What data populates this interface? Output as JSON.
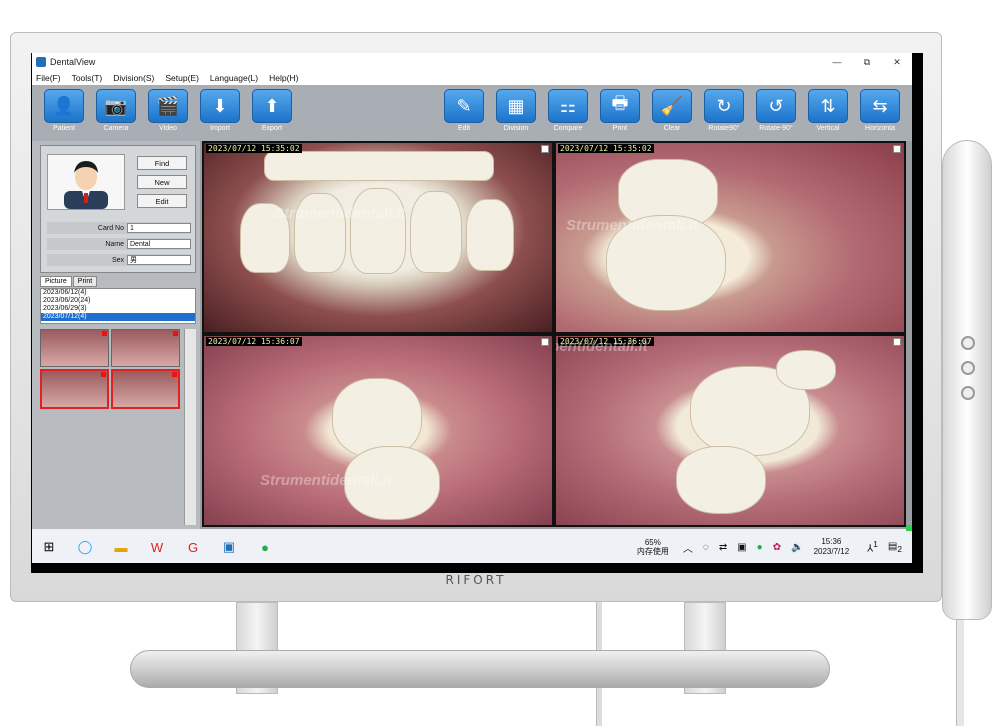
{
  "monitor": {
    "brand": "RIFORT"
  },
  "window": {
    "title": "DentalView",
    "controls": [
      "—",
      "⧉",
      "✕"
    ]
  },
  "menu": [
    "File(F)",
    "Tools(T)",
    "Division(S)",
    "Setup(E)",
    "Language(L)",
    "Help(H)"
  ],
  "toolbar_left": [
    {
      "label": "Patient",
      "icon": "patient-icon",
      "glyph": "👤"
    },
    {
      "label": "Camera",
      "icon": "camera-icon",
      "glyph": "📷"
    },
    {
      "label": "Video",
      "icon": "video-icon",
      "glyph": "🎬"
    },
    {
      "label": "Import",
      "icon": "import-icon",
      "glyph": "⬇"
    },
    {
      "label": "Export",
      "icon": "export-icon",
      "glyph": "⬆"
    }
  ],
  "toolbar_right": [
    {
      "label": "Edit",
      "icon": "edit-icon",
      "glyph": "✎"
    },
    {
      "label": "Division",
      "icon": "division-icon",
      "glyph": "▦"
    },
    {
      "label": "Compare",
      "icon": "compare-icon",
      "glyph": "⚏"
    },
    {
      "label": "Print",
      "icon": "print-icon",
      "glyph": "🖶"
    },
    {
      "label": "Clear",
      "icon": "clear-icon",
      "glyph": "🧹"
    },
    {
      "label": "Rotate90°",
      "icon": "rotate-cw-icon",
      "glyph": "↻"
    },
    {
      "label": "Rotate-90°",
      "icon": "rotate-ccw-icon",
      "glyph": "↺"
    },
    {
      "label": "Vertical",
      "icon": "flip-vertical-icon",
      "glyph": "⇅"
    },
    {
      "label": "Horizonta",
      "icon": "flip-horizontal-icon",
      "glyph": "⇆"
    }
  ],
  "patient": {
    "find": "Find",
    "new": "New",
    "edit": "Edit",
    "card_label": "Card No",
    "card_value": "1",
    "name_label": "Name",
    "name_value": "Dental",
    "sex_label": "Sex",
    "sex_value": "男"
  },
  "tabs": [
    "Picture",
    "Print"
  ],
  "dates": [
    "2023/06/12(4)",
    "2023/06/20(24)",
    "2023/06/29(3)",
    "2023/07/12(4)"
  ],
  "selected_date": "2023/07/12(4)",
  "images": [
    {
      "timestamp": "2023/07/12 15:35:02"
    },
    {
      "timestamp": "2023/07/12 15:35:02"
    },
    {
      "timestamp": "2023/07/12 15:36:07"
    },
    {
      "timestamp": "2023/07/12 15:36:07"
    }
  ],
  "watermark": "Strumentidentali.it",
  "taskbar": {
    "memory_pct": "65%",
    "memory_label": "内存使用",
    "time": "15:36",
    "date": "2023/7/12",
    "badge": "1",
    "notif": "2"
  }
}
